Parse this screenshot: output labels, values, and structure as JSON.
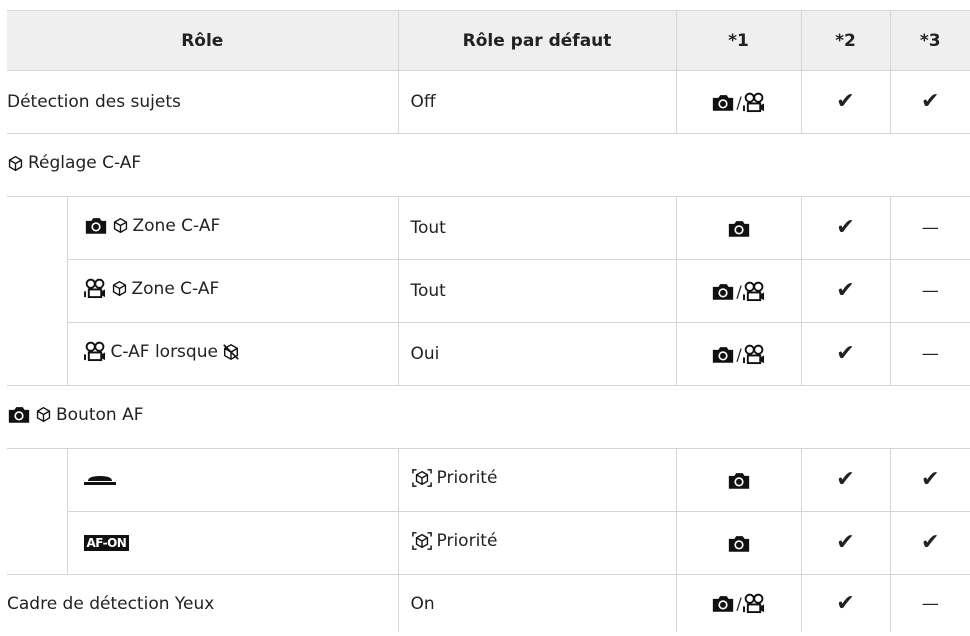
{
  "headers": {
    "role": "Rôle",
    "default_role": "Rôle par défaut",
    "n1": "*1",
    "n2": "*2",
    "n3": "*3"
  },
  "rows": [
    {
      "role": "Détection des sujets",
      "default": "Off",
      "c1": "photo/movie",
      "c2": "✔",
      "c3": "✔"
    },
    {
      "section": "Réglage C-AF"
    },
    {
      "role": "Zone C-AF",
      "default": "Tout",
      "c1": "photo",
      "c2": "✔",
      "c3": "—"
    },
    {
      "role": "Zone C-AF",
      "default": "Tout",
      "c1": "photo/movie",
      "c2": "✔",
      "c3": "—"
    },
    {
      "role": "C-AF lorsque",
      "default": "Oui",
      "c1": "photo/movie",
      "c2": "✔",
      "c3": "—"
    },
    {
      "section": "Bouton AF"
    },
    {
      "role": "shutter-button-icon",
      "default": "Priorité",
      "c1": "photo",
      "c2": "✔",
      "c3": "✔"
    },
    {
      "role": "AF-ON",
      "default": "Priorité",
      "c1": "photo",
      "c2": "✔",
      "c3": "✔"
    },
    {
      "role": "Cadre de détection Yeux",
      "default": "On",
      "c1": "photo/movie",
      "c2": "✔",
      "c3": "—"
    }
  ],
  "slash": "/"
}
